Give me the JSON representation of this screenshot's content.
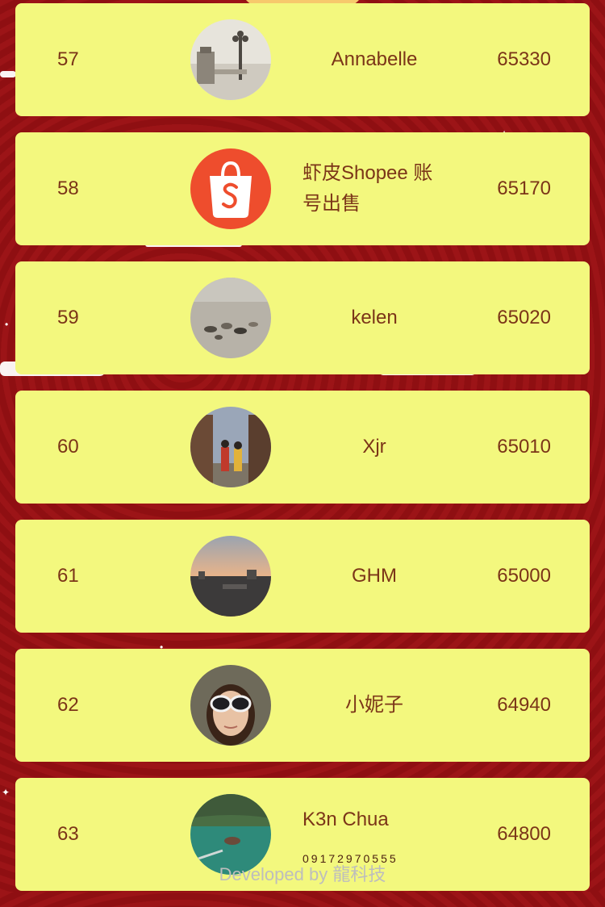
{
  "leaderboard": {
    "rows": [
      {
        "rank": "57",
        "name": "Annabelle",
        "score": "65330",
        "avatar_icon": "landscape-avatar-icon"
      },
      {
        "rank": "58",
        "name": "虾皮Shopee 账号出售",
        "score": "65170",
        "avatar_icon": "shopee-bag-icon"
      },
      {
        "rank": "59",
        "name": "kelen",
        "score": "65020",
        "avatar_icon": "beach-avatar-icon"
      },
      {
        "rank": "60",
        "name": "Xjr",
        "score": "65010",
        "avatar_icon": "street-avatar-icon"
      },
      {
        "rank": "61",
        "name": "GHM",
        "score": "65000",
        "avatar_icon": "sunset-avatar-icon"
      },
      {
        "rank": "62",
        "name": "小妮子",
        "score": "64940",
        "avatar_icon": "portrait-avatar-icon"
      },
      {
        "rank": "63",
        "name": "K3n Chua",
        "score": "64800",
        "name_sub": "09172970555",
        "avatar_icon": "river-avatar-icon"
      }
    ]
  },
  "footer": {
    "credit": "Developed by 龍科技"
  },
  "colors": {
    "row_background": "#f3f87e",
    "text": "#7b3518",
    "page_background": "#921114",
    "shopee_orange": "#ee4d2d"
  }
}
